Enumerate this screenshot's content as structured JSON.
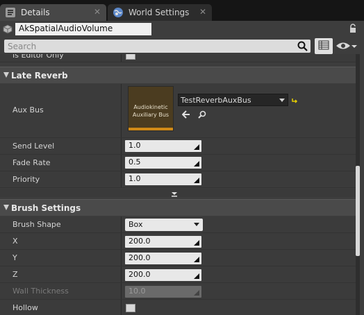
{
  "tabs": [
    {
      "label": "Details",
      "icon": "details-icon",
      "active": true
    },
    {
      "label": "World Settings",
      "icon": "globe-icon",
      "active": false
    }
  ],
  "actor": {
    "name": "AkSpatialAudioVolume",
    "icon": "volume-actor-icon"
  },
  "search": {
    "placeholder": "Search",
    "value": ""
  },
  "properties": {
    "is_editor_only": {
      "label": "Is Editor Only",
      "checked": false
    },
    "late_reverb": {
      "title": "Late Reverb",
      "aux_bus": {
        "label": "Aux Bus",
        "thumbnail_text": "Audiokinetic Auxiliary Bus",
        "value": "TestReverbAuxBus"
      },
      "send_level": {
        "label": "Send Level",
        "value": "1.0"
      },
      "fade_rate": {
        "label": "Fade Rate",
        "value": "0.5"
      },
      "priority": {
        "label": "Priority",
        "value": "1.0"
      }
    },
    "brush_settings": {
      "title": "Brush Settings",
      "brush_shape": {
        "label": "Brush Shape",
        "value": "Box"
      },
      "x": {
        "label": "X",
        "value": "200.0"
      },
      "y": {
        "label": "Y",
        "value": "200.0"
      },
      "z": {
        "label": "Z",
        "value": "200.0"
      },
      "wall_thickness": {
        "label": "Wall Thickness",
        "value": "10.0"
      },
      "hollow": {
        "label": "Hollow",
        "checked": false
      }
    }
  },
  "colors": {
    "accent": "#d08a17",
    "panel": "#3d3d3d",
    "category": "#4a4a4a"
  }
}
